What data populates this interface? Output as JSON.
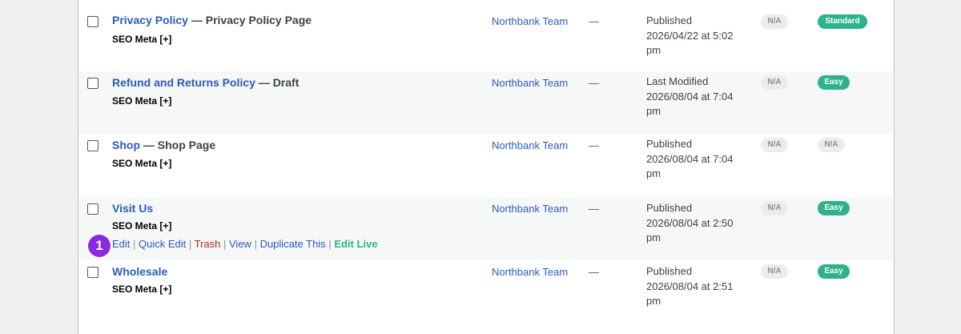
{
  "rows": [
    {
      "title": "Privacy Policy",
      "state": " — Privacy Policy Page",
      "seo_meta": "SEO Meta [+]",
      "author": "Northbank Team",
      "dash": "—",
      "date_status": "Published",
      "date_value": "2026/04/22 at 5:02",
      "date_suffix": "pm",
      "badge1": "N/A",
      "badge2": "Standard"
    },
    {
      "title": "Refund and Returns Policy",
      "state": " — Draft",
      "seo_meta": "SEO Meta [+]",
      "author": "Northbank Team",
      "dash": "—",
      "date_status": "Last Modified",
      "date_value": "2026/08/04 at 7:04",
      "date_suffix": "pm",
      "badge1": "N/A",
      "badge2": "Easy"
    },
    {
      "title": "Shop",
      "state": " — Shop Page",
      "seo_meta": "SEO Meta [+]",
      "author": "Northbank Team",
      "dash": "—",
      "date_status": "Published",
      "date_value": "2026/08/04 at 7:04",
      "date_suffix": "pm",
      "badge1": "N/A",
      "badge2": "N/A"
    },
    {
      "title": "Visit Us",
      "state": "",
      "seo_meta": "SEO Meta [+]",
      "author": "Northbank Team",
      "dash": "—",
      "date_status": "Published",
      "date_value": "2026/08/04 at 2:50",
      "date_suffix": "pm",
      "badge1": "N/A",
      "badge2": "Easy",
      "actions": {
        "edit": "Edit",
        "quick_edit": "Quick Edit",
        "trash": "Trash",
        "view": "View",
        "duplicate": "Duplicate This",
        "edit_live": "Edit Live",
        "sep": " | "
      }
    },
    {
      "title": "Wholesale",
      "state": "",
      "seo_meta": "SEO Meta [+]",
      "author": "Northbank Team",
      "dash": "—",
      "date_status": "Published",
      "date_value": "2026/08/04 at 2:51",
      "date_suffix": "pm",
      "badge1": "N/A",
      "badge2": "Easy"
    }
  ],
  "marker": {
    "label": "1"
  },
  "colors": {
    "link": "#2c5bbf",
    "trash": "#b32d2e",
    "badge_green": "#2eb28e",
    "marker_purple": "#8a2be2"
  }
}
